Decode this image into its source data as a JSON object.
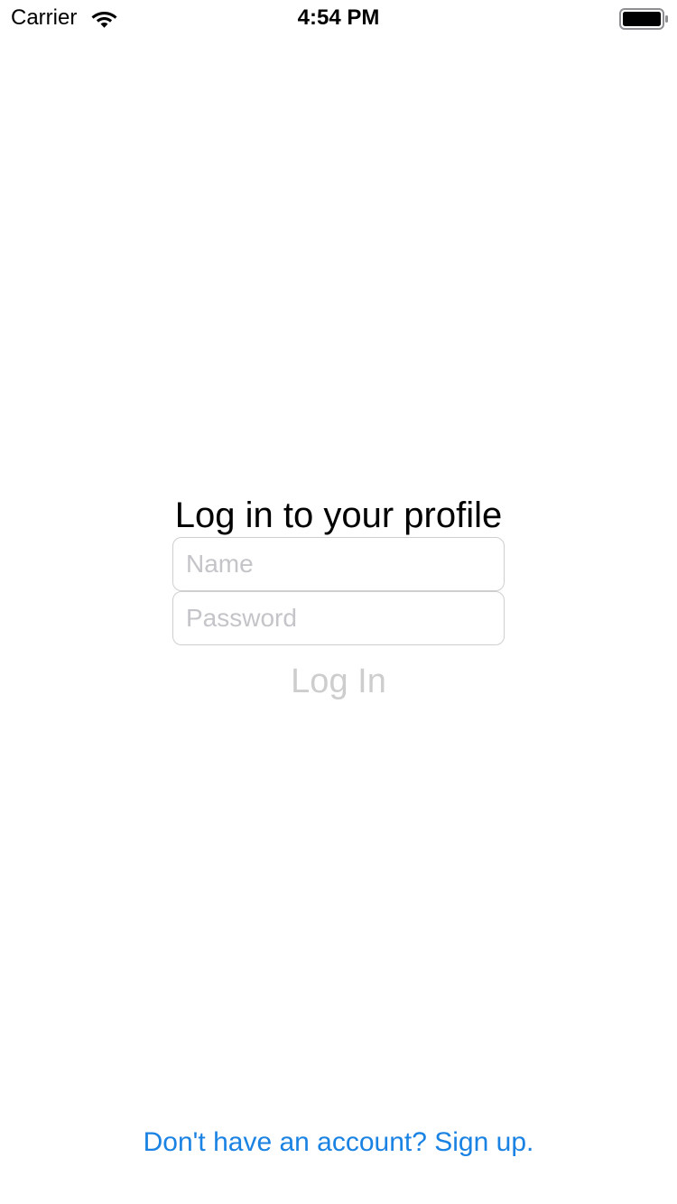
{
  "status_bar": {
    "carrier": "Carrier",
    "time": "4:54 PM",
    "wifi_icon": "wifi-icon",
    "battery_icon": "battery-icon"
  },
  "login": {
    "title": "Log in to your profile",
    "name_placeholder": "Name",
    "name_value": "",
    "password_placeholder": "Password",
    "password_value": "",
    "login_button_label": "Log In",
    "login_button_color": "#cdcdcd"
  },
  "footer": {
    "signup_link": "Don't have an account? Sign up.",
    "link_color": "#1a82e2"
  }
}
